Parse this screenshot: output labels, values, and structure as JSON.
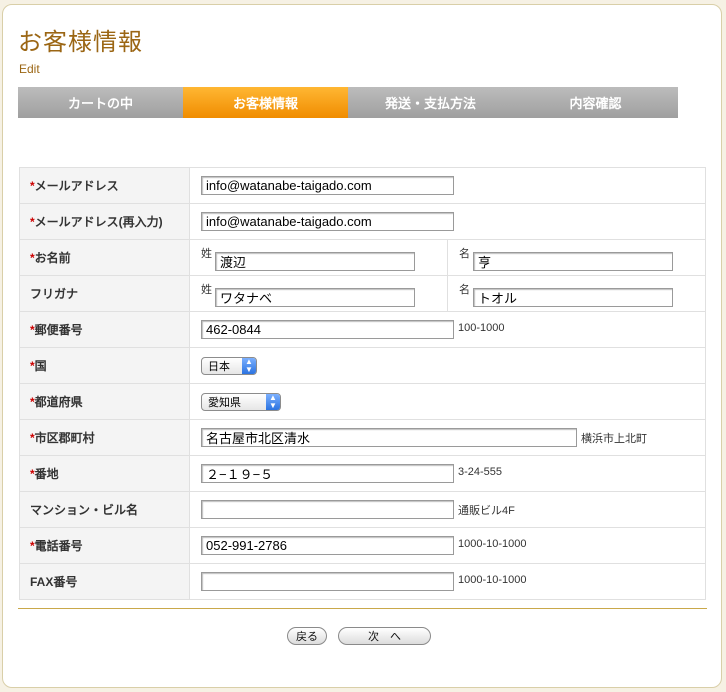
{
  "header": {
    "title": "お客様情報",
    "edit": "Edit"
  },
  "steps": [
    "カートの中",
    "お客様情報",
    "発送・支払方法",
    "内容確認"
  ],
  "form": {
    "required_mark": "*",
    "email": {
      "label": "メールアドレス",
      "value": "info@watanabe-taigado.com"
    },
    "email_confirm": {
      "label": "メールアドレス(再入力)",
      "value": "info@watanabe-taigado.com"
    },
    "name": {
      "label": "お名前",
      "sei_tag": "姓",
      "sei": "渡辺",
      "mei_tag": "名",
      "mei": "亨"
    },
    "kana": {
      "label": "フリガナ",
      "sei_tag": "姓",
      "sei": "ワタナベ",
      "mei_tag": "名",
      "mei": "トオル"
    },
    "zip": {
      "label": "郵便番号",
      "value": "462-0844",
      "hint": "100-1000"
    },
    "country": {
      "label": "国",
      "value": "日本"
    },
    "prefecture": {
      "label": "都道府県",
      "value": "愛知県"
    },
    "city": {
      "label": "市区郡町村",
      "value": "名古屋市北区清水",
      "hint": "横浜市上北町"
    },
    "address": {
      "label": "番地",
      "value": "２−１９−５",
      "hint": "3-24-555"
    },
    "building": {
      "label": "マンション・ビル名",
      "value": "",
      "hint": "通販ビル4F"
    },
    "phone": {
      "label": "電話番号",
      "value": "052-991-2786",
      "hint": "1000-10-1000"
    },
    "fax": {
      "label": "FAX番号",
      "value": "",
      "hint": "1000-10-1000"
    }
  },
  "buttons": {
    "back": "戻る",
    "next": "次　へ"
  }
}
